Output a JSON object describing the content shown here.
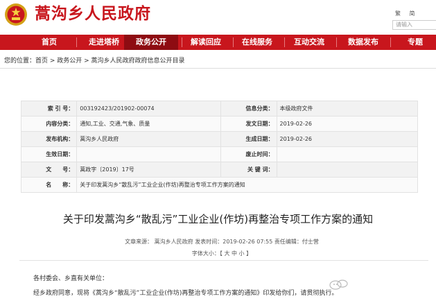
{
  "header": {
    "title": "蒿沟乡人民政府",
    "links": [
      "繁",
      "简"
    ],
    "search_placeholder": "请输入"
  },
  "nav": {
    "items": [
      "首页",
      "走进塔桥",
      "政务公开",
      "解读回应",
      "在线服务",
      "互动交流",
      "数据发布",
      "专题"
    ],
    "active_index": 2
  },
  "breadcrumb": "您的位置：首页 > 政务公开 > 蒿沟乡人民政府政府信息公开目录",
  "info": {
    "rows": [
      {
        "l1": "索 引 号：",
        "v1": "003192423/201902-00074",
        "l2": "信息分类：",
        "v2": "本级政府文件"
      },
      {
        "l1": "内容分类：",
        "v1": "通知,工业、交通,气象、质量",
        "l2": "发文日期：",
        "v2": "2019-02-26"
      },
      {
        "l1": "发布机构：",
        "v1": "蒿沟乡人民政府",
        "l2": "生成日期：",
        "v2": "2019-02-26"
      },
      {
        "l1": "生效日期：",
        "v1": "",
        "l2": "废止时间：",
        "v2": ""
      },
      {
        "l1": "文　　号：",
        "v1": "蒿政字〔2019〕17号",
        "l2": "关 键 词：",
        "v2": ""
      }
    ],
    "name_label": "名　　称：",
    "name_value": "关于印发蒿沟乡“散乱污”工业企业(作坊)再整治专项工作方案的通知"
  },
  "article": {
    "title": "关于印发蒿沟乡“散乱污”工业企业(作坊)再整治专项工作方案的通知",
    "meta": "文章来源：  蒿沟乡人民政府  发表时间：2019-02-26 07:55  责任编辑：付士营",
    "font_size_label": "字体大小：【 大  中  小 】",
    "p1": "各村委会、乡直有关单位：",
    "p2": "经乡政府同意，现将《蒿沟乡“散乱污”工业企业(作坊)再整治专项工作方案的通知》印发给你们，请贯彻执行。"
  },
  "colors": {
    "brand": "#c8161d",
    "nav_active": "#8e0c12"
  }
}
